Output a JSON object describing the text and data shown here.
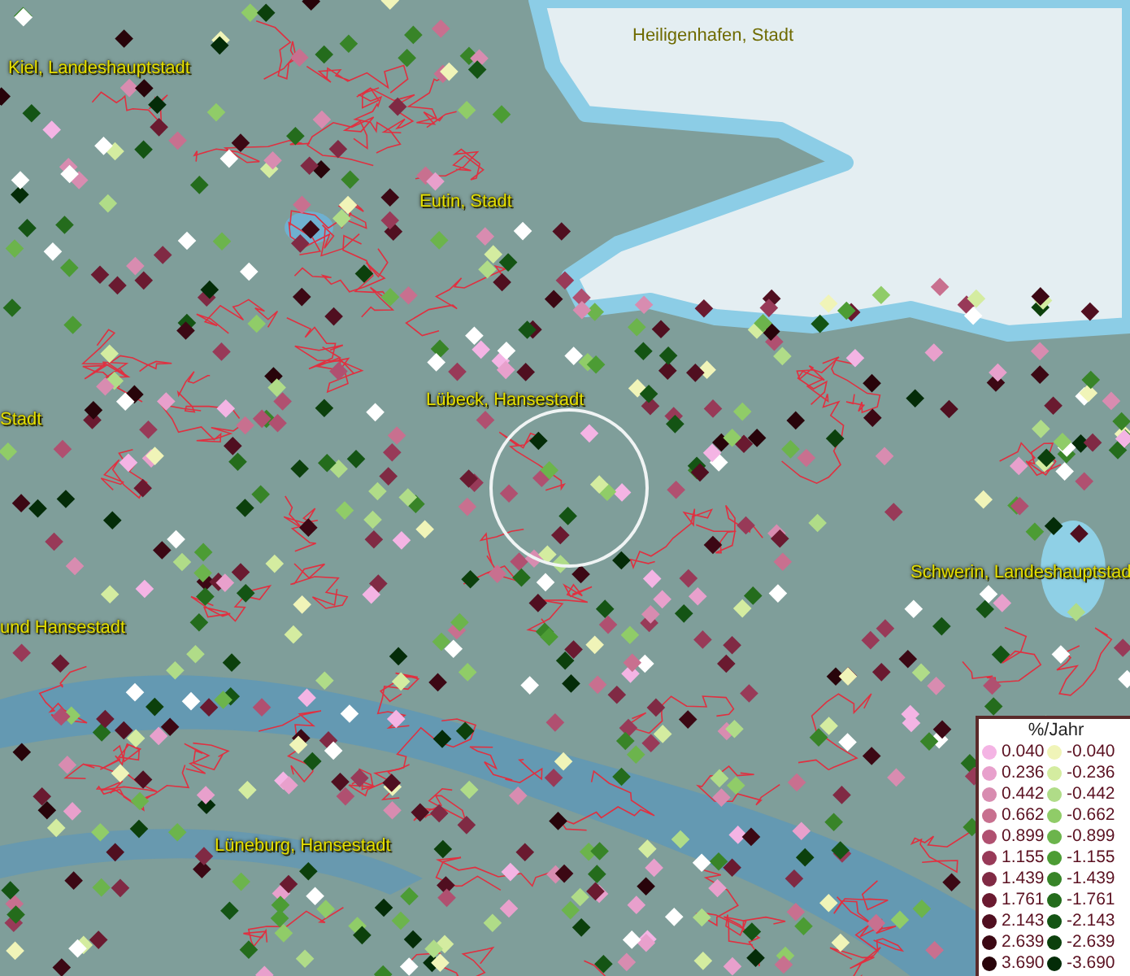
{
  "map": {
    "place_labels": [
      {
        "name": "Heiligenhafen, Stadt"
      },
      {
        "name": "Kiel, Landeshauptstadt"
      },
      {
        "name": "Eutin, Stadt"
      },
      {
        "name": "Lübeck, Hansestadt"
      },
      {
        "name": "Stadt"
      },
      {
        "name": "Schwerin, Landeshauptstad"
      },
      {
        "name": "und Hansestadt"
      },
      {
        "name": "Lüneburg, Hansestadt"
      }
    ]
  },
  "legend": {
    "title": "%/Jahr",
    "entries": [
      {
        "label": "0.040",
        "color": "#f4b4e4"
      },
      {
        "label": "-0.040",
        "color": "#f0f4b8"
      },
      {
        "label": "0.236",
        "color": "#e8a0cc"
      },
      {
        "label": "-0.236",
        "color": "#d4eca0"
      },
      {
        "label": "0.442",
        "color": "#d88cb0"
      },
      {
        "label": "-0.442",
        "color": "#b0dc88"
      },
      {
        "label": "0.662",
        "color": "#c8708f"
      },
      {
        "label": "-0.662",
        "color": "#90cc68"
      },
      {
        "label": "0.899",
        "color": "#b05070"
      },
      {
        "label": "-0.899",
        "color": "#6cb44c"
      },
      {
        "label": "1.155",
        "color": "#983a58"
      },
      {
        "label": "-1.155",
        "color": "#4c9c34"
      },
      {
        "label": "1.439",
        "color": "#802a44"
      },
      {
        "label": "-1.439",
        "color": "#388428"
      },
      {
        "label": "1.761",
        "color": "#6a1a30"
      },
      {
        "label": "-1.761",
        "color": "#246c1c"
      },
      {
        "label": "2.143",
        "color": "#500f20"
      },
      {
        "label": "-2.143",
        "color": "#145414"
      },
      {
        "label": "2.639",
        "color": "#3c0814"
      },
      {
        "label": "-2.639",
        "color": "#0c400c"
      },
      {
        "label": "3.690",
        "color": "#28040a"
      },
      {
        "label": "-3.690",
        "color": "#042c08"
      }
    ]
  }
}
